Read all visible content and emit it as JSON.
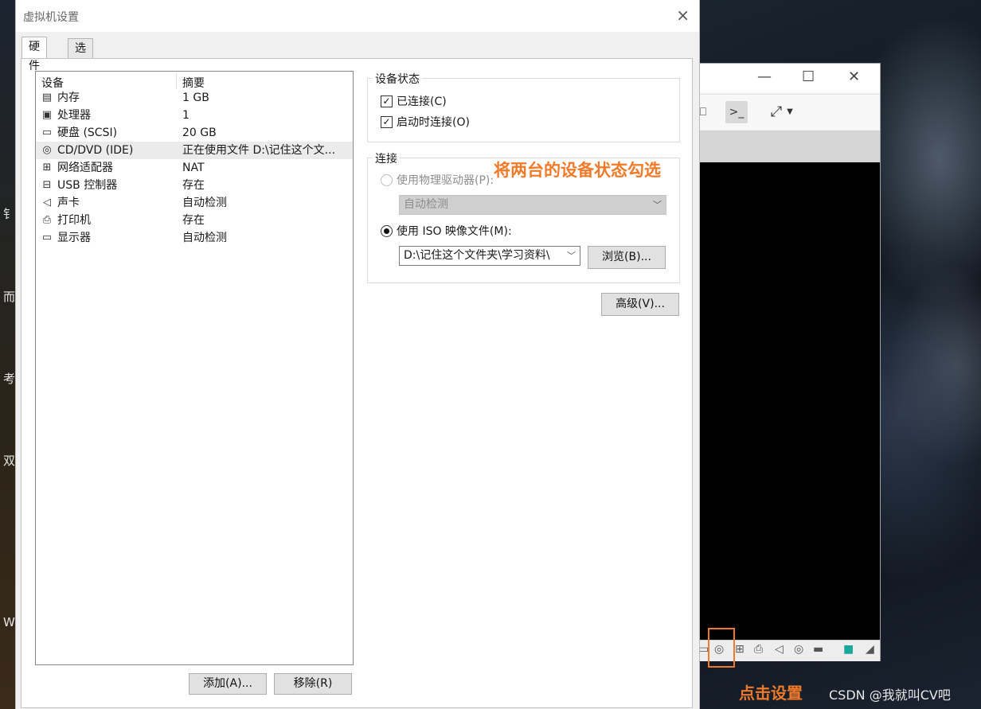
{
  "dialog": {
    "title": "虚拟机设置",
    "close": "×",
    "tabs": [
      {
        "label": "硬件",
        "active": true
      },
      {
        "label": "选项",
        "active": false
      }
    ]
  },
  "device_list": {
    "headers": {
      "device": "设备",
      "summary": "摘要"
    },
    "rows": [
      {
        "icon": "memory-icon",
        "name": "内存",
        "summary": "1 GB"
      },
      {
        "icon": "processor-icon",
        "name": "处理器",
        "summary": "1"
      },
      {
        "icon": "hard-disk-icon",
        "name": "硬盘 (SCSI)",
        "summary": "20 GB"
      },
      {
        "icon": "cd-dvd-icon",
        "name": "CD/DVD (IDE)",
        "summary": "正在使用文件 D:\\记住这个文...",
        "selected": true
      },
      {
        "icon": "network-adapter-icon",
        "name": "网络适配器",
        "summary": "NAT"
      },
      {
        "icon": "usb-icon",
        "name": "USB 控制器",
        "summary": "存在"
      },
      {
        "icon": "sound-card-icon",
        "name": "声卡",
        "summary": "自动检测"
      },
      {
        "icon": "printer-icon",
        "name": "打印机",
        "summary": "存在"
      },
      {
        "icon": "display-icon",
        "name": "显示器",
        "summary": "自动检测"
      }
    ],
    "add_button": "添加(A)...",
    "remove_button": "移除(R)"
  },
  "device_status": {
    "title": "设备状态",
    "connected": {
      "label": "已连接(C)",
      "checked": true
    },
    "connect_at_power_on": {
      "label": "启动时连接(O)",
      "checked": true
    }
  },
  "connection": {
    "title": "连接",
    "physical_drive": {
      "label": "使用物理驱动器(P):",
      "selected": false,
      "disabled": true
    },
    "physical_drive_value": "自动检测",
    "iso_image": {
      "label": "使用 ISO 映像文件(M):",
      "selected": true
    },
    "iso_path": "D:\\记住这个文件夹\\学习资料\\",
    "browse_button": "浏览(B)..."
  },
  "advanced_button": "高级(V)...",
  "annotations": {
    "check_status": "将两台的设备状态勾选",
    "click_settings": "点击设置"
  },
  "watermark": "CSDN @我就叫CV吧",
  "colors": {
    "annotation": "#f07a2a",
    "selected_row": "#ebebeb",
    "button_bg": "#e1e1e1"
  }
}
